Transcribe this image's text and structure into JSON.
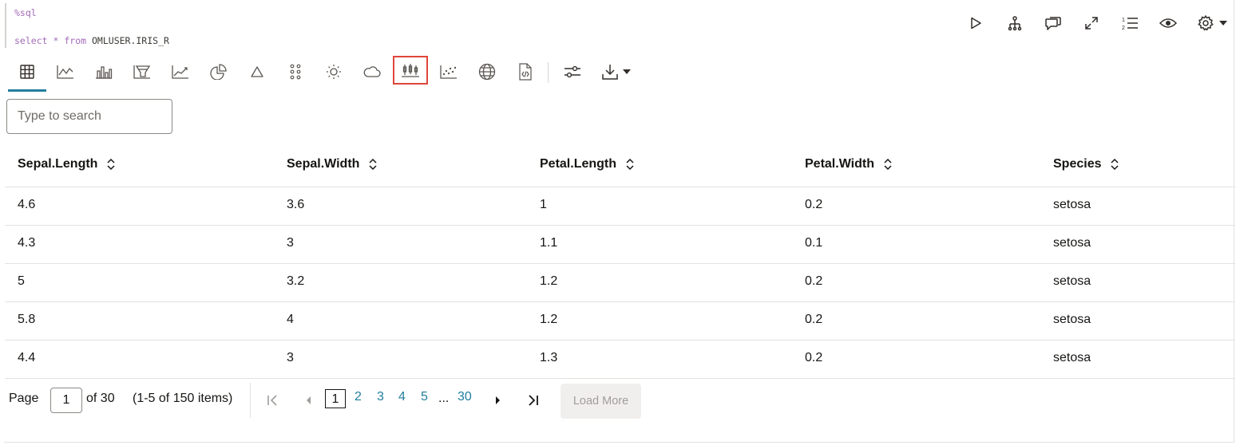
{
  "code": {
    "magic": "%sql",
    "select_kw": "select",
    "star": "*",
    "from_kw": "from",
    "table_ref": "OMLUSER.IRIS_R"
  },
  "paragraph_toolbar": [
    "run-icon",
    "hierarchy-icon",
    "comments-icon",
    "expand-icon",
    "numbered-list-icon",
    "eye-icon",
    "gear-icon",
    "caret-down-icon"
  ],
  "chart_toolbar": [
    "table-icon",
    "line-chart-icon",
    "bar-chart-icon",
    "funnel-chart-icon",
    "area-chart-icon",
    "pie-chart-icon",
    "pyramid-icon",
    "dots-grid-icon",
    "sunburst-icon",
    "tag-cloud-icon",
    "box-plot-icon",
    "scatter-plot-icon",
    "globe-icon",
    "script-icon",
    "settings-sliders-icon",
    "download-icon",
    "caret-down-icon"
  ],
  "search": {
    "placeholder": "Type to search"
  },
  "table": {
    "columns": [
      "Sepal.Length",
      "Sepal.Width",
      "Petal.Length",
      "Petal.Width",
      "Species"
    ],
    "rows": [
      [
        "4.6",
        "3.6",
        "1",
        "0.2",
        "setosa"
      ],
      [
        "4.3",
        "3",
        "1.1",
        "0.1",
        "setosa"
      ],
      [
        "5",
        "3.2",
        "1.2",
        "0.2",
        "setosa"
      ],
      [
        "5.8",
        "4",
        "1.2",
        "0.2",
        "setosa"
      ],
      [
        "4.4",
        "3",
        "1.3",
        "0.2",
        "setosa"
      ]
    ]
  },
  "pagination": {
    "page_label": "Page",
    "current_page": "1",
    "of_label": "of 30",
    "range_label": "(1-5 of 150 items)",
    "pages": [
      "1",
      "2",
      "3",
      "4",
      "5"
    ],
    "ellipsis": "...",
    "last_page": "30",
    "load_more": "Load More"
  },
  "colors": {
    "accent": "#227e9e",
    "highlight": "#e0463c",
    "keyword": "#a36ab8"
  }
}
